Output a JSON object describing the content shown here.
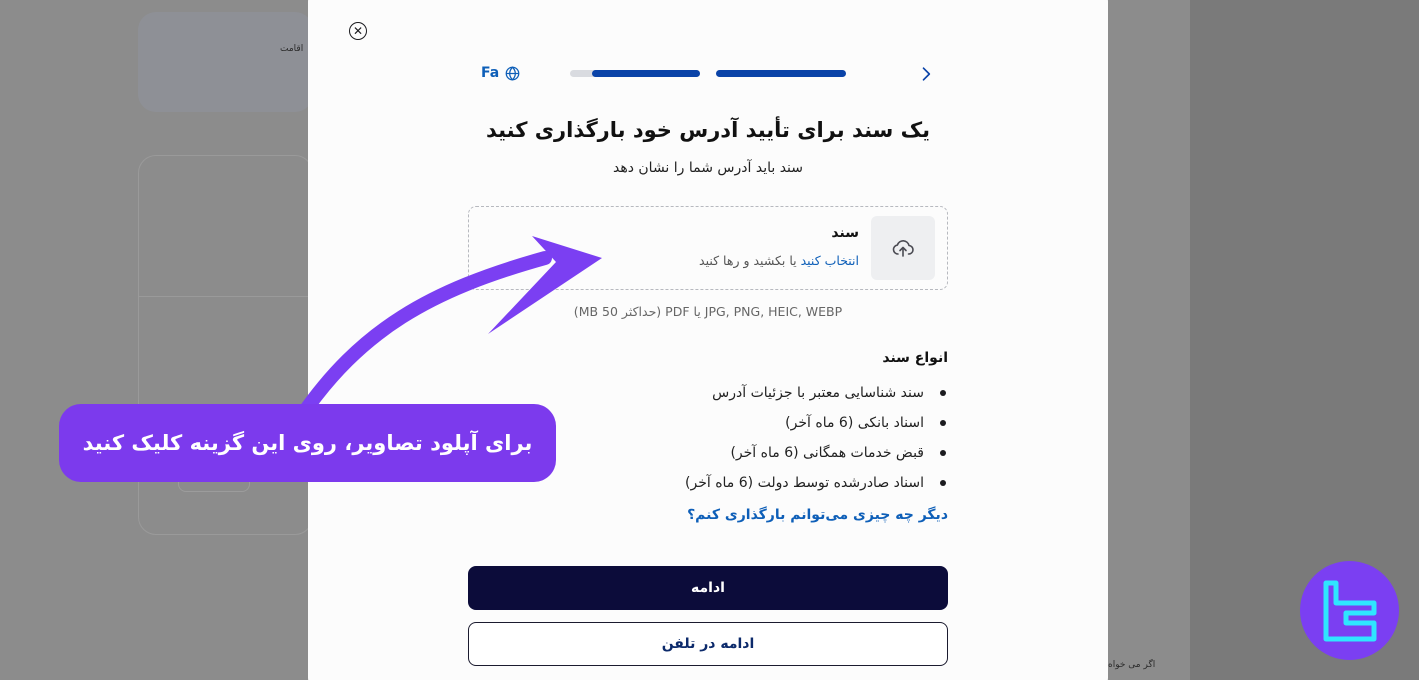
{
  "background": {
    "label_top": "اقامت",
    "label_bottom": "اگر می خواه"
  },
  "modal": {
    "language_label": "Fa",
    "title": "یک سند برای تأیید آدرس خود بارگذاری کنید",
    "subtitle": "سند باید آدرس شما را نشان دهد",
    "upload": {
      "label": "سند",
      "select_link": "انتخاب کنید",
      "drag_text": "یا بکشید و رها کنید"
    },
    "formats_hint": "JPG, PNG, HEIC, WEBP یا PDF (حداکثر 50 MB)",
    "document_types": {
      "heading": "انواع سند",
      "items": [
        "سند شناسایی معتبر با جزئیات آدرس",
        "اسناد بانکی (6 ماه آخر)",
        "قبض خدمات همگانی (6 ماه آخر)",
        "اسناد صادرشده توسط دولت (6 ماه آخر)"
      ]
    },
    "more_link": "دیگر چه چیزی می‌توانم بارگذاری کنم؟",
    "continue_button": "ادامه",
    "continue_phone_button": "ادامه در تلفن",
    "progress": {
      "step1_fill": 0.83,
      "step2_fill": 1.0
    }
  },
  "annotation": {
    "callout_text": "برای آپلود تصاویر، روی این گزینه کلیک کنید"
  },
  "colors": {
    "accent_blue": "#0a43a8",
    "link_blue": "#0e5fb8",
    "primary_button": "#0c0c3a",
    "annotation_purple": "#7c3aed"
  }
}
